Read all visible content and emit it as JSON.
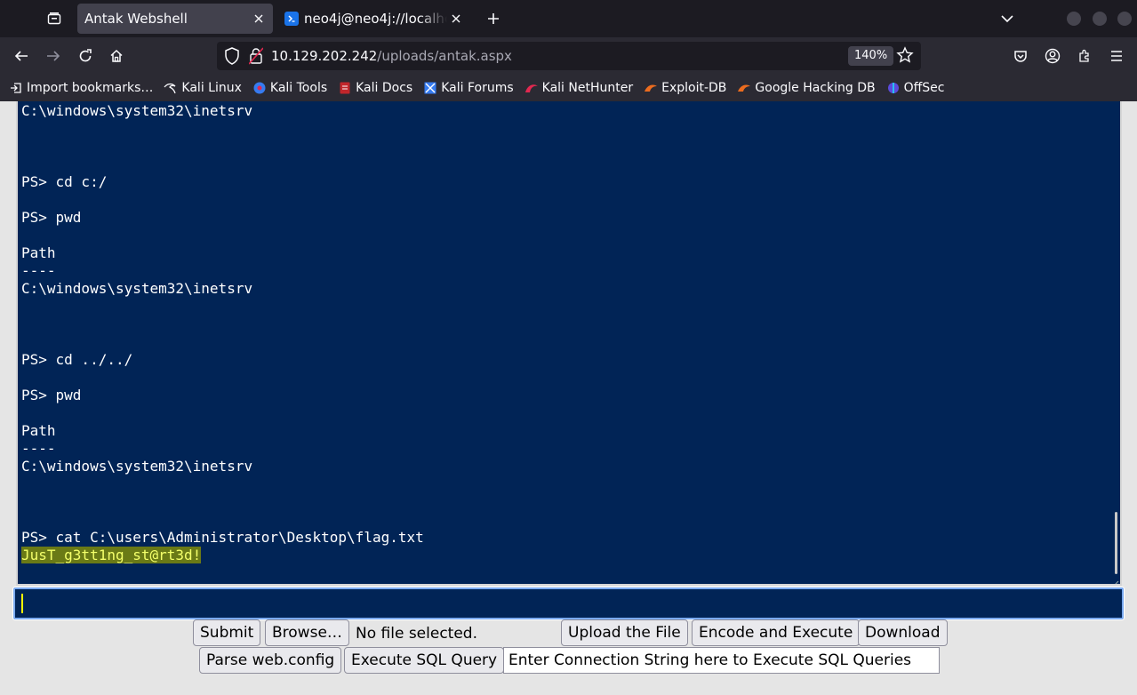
{
  "browser": {
    "tabs": [
      {
        "title": "Antak Webshell",
        "active": true
      },
      {
        "title": "neo4j@neo4j://localhost:7687",
        "active": false
      }
    ],
    "url": {
      "host": "10.129.202.242",
      "path": "/uploads/antak.aspx"
    },
    "zoom": "140%",
    "bookmarks": [
      {
        "label": "Import bookmarks…",
        "icon": "import-icon"
      },
      {
        "label": "Kali Linux",
        "icon": "kali-dragon-icon"
      },
      {
        "label": "Kali Tools",
        "icon": "kali-tools-icon"
      },
      {
        "label": "Kali Docs",
        "icon": "kali-docs-icon"
      },
      {
        "label": "Kali Forums",
        "icon": "kali-forums-icon"
      },
      {
        "label": "Kali NetHunter",
        "icon": "nethunter-icon"
      },
      {
        "label": "Exploit-DB",
        "icon": "exploit-db-icon"
      },
      {
        "label": "Google Hacking DB",
        "icon": "ghdb-icon"
      },
      {
        "label": "OffSec",
        "icon": "offsec-icon"
      }
    ]
  },
  "console": {
    "output": "C:\\windows\\system32\\inetsrv\n\n\n\nPS> cd c:/\n\nPS> pwd\n\nPath\n----\nC:\\windows\\system32\\inetsrv\n\n\n\nPS> cd ../../\n\nPS> pwd\n\nPath\n----\nC:\\windows\\system32\\inetsrv\n\n\n\nPS> cat C:\\users\\Administrator\\Desktop\\flag.txt",
    "flag": "JusT_g3tt1ng_st@rt3d!",
    "command_value": ""
  },
  "controls": {
    "submit": "Submit",
    "browse": "Browse…",
    "file_status": "No file selected.",
    "upload": "Upload the File",
    "encode": "Encode and Execute",
    "download": "Download",
    "parse": "Parse web.config",
    "sql": "Execute SQL Query",
    "connection_placeholder": "Enter Connection String here to Execute SQL Queries"
  },
  "colors": {
    "console_bg": "#012456",
    "flag_highlight": "#6a7a16",
    "flag_text": "#f3ff6a",
    "chrome_dark": "#1c1b22",
    "chrome_toolbar": "#2b2a33"
  }
}
